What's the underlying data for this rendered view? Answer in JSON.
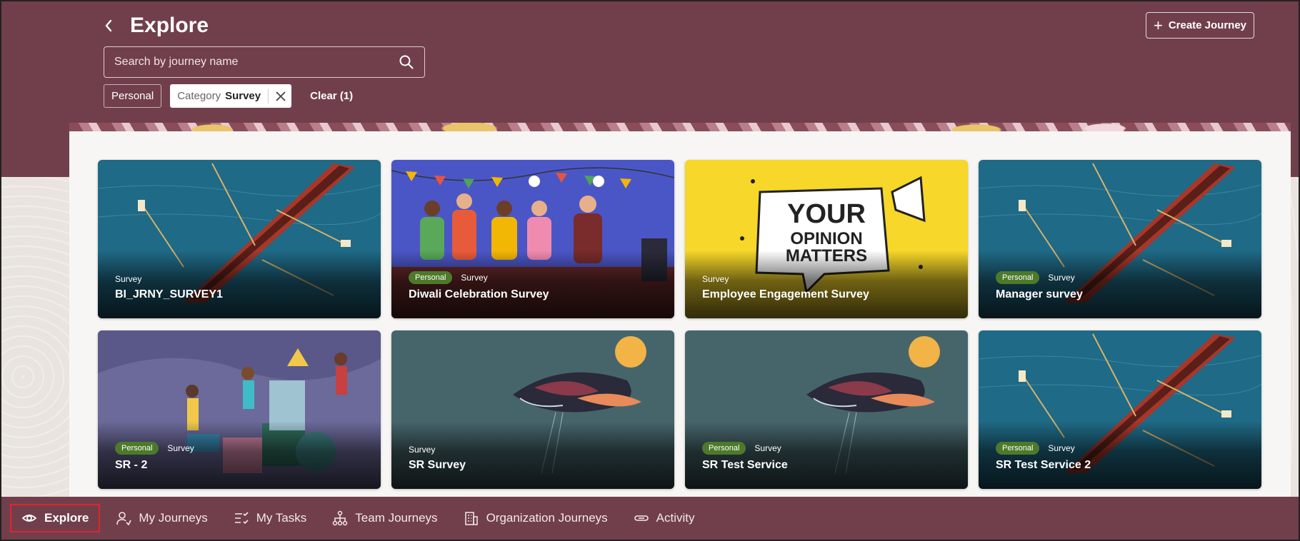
{
  "header": {
    "title": "Explore",
    "create_label": "Create Journey"
  },
  "search": {
    "placeholder": "Search by journey name"
  },
  "filters": {
    "personal_label": "Personal",
    "category_label": "Category",
    "category_value": "Survey",
    "clear_label": "Clear (1)"
  },
  "cards": [
    {
      "title": "BI_JRNY_SURVEY1",
      "category": "Survey",
      "personal": ""
    },
    {
      "title": "Diwali Celebration Survey",
      "category": "Survey",
      "personal": "Personal"
    },
    {
      "title": "Employee Engagement Survey",
      "category": "Survey",
      "personal": "",
      "art_text": [
        "YOUR",
        "OPINION",
        "MATTERS"
      ]
    },
    {
      "title": "Manager survey",
      "category": "Survey",
      "personal": "Personal"
    },
    {
      "title": "SR - 2",
      "category": "Survey",
      "personal": "Personal"
    },
    {
      "title": "SR Survey",
      "category": "Survey",
      "personal": ""
    },
    {
      "title": "SR Test Service",
      "category": "Survey",
      "personal": "Personal"
    },
    {
      "title": "SR Test Service 2",
      "category": "Survey",
      "personal": "Personal"
    }
  ],
  "nav": {
    "items": [
      {
        "label": "Explore",
        "icon": "eye-icon"
      },
      {
        "label": "My Journeys",
        "icon": "person-route-icon"
      },
      {
        "label": "My Tasks",
        "icon": "task-list-icon"
      },
      {
        "label": "Team Journeys",
        "icon": "org-chart-icon"
      },
      {
        "label": "Organization Journeys",
        "icon": "building-icon"
      },
      {
        "label": "Activity",
        "icon": "link-icon"
      }
    ]
  },
  "colors": {
    "brand": "#713f4b",
    "personal_badge": "#4d7a2a",
    "active_outline": "#e0242e"
  }
}
